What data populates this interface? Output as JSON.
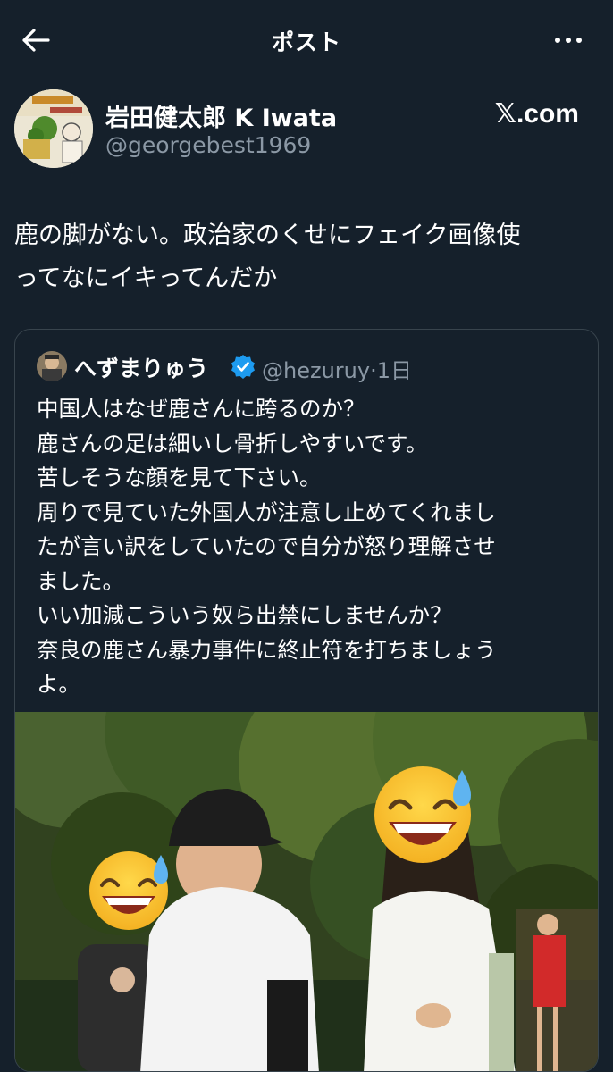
{
  "header": {
    "title": "ポスト",
    "back_icon": "arrow-left-icon",
    "more_icon": "more-horizontal-icon"
  },
  "author": {
    "name": "岩田健太郎 K Iwata",
    "handle": "@georgebest1969",
    "source": "𝕏.com"
  },
  "post": {
    "text": "鹿の脚がない。政治家のくせにフェイク画像使\nってなにイキってんだか"
  },
  "quoted": {
    "name": "へずまりゅう",
    "verified_icon": "verified-badge-icon",
    "handle": "@hezuruy",
    "separator": "·",
    "time": "1日",
    "text": "中国人はなぜ鹿さんに跨るのか？\n鹿さんの足は細いし骨折しやすいです。\n苦しそうな顔を見て下さい。\n周りで見ていた外国人が注意し止めてくれまし\nたが言い訳をしていたので自分が怒り理解させ\nました。\nいい加減こういう奴ら出禁にしませんか？\n奈良の鹿さん暴力事件に終止符を打ちましょう\nよ。",
    "image_alt_icon": "photo-icon"
  },
  "colors": {
    "background": "#15202b",
    "secondary_text": "#8b98a5",
    "border": "#38444d",
    "verified": "#1d9bf0"
  }
}
